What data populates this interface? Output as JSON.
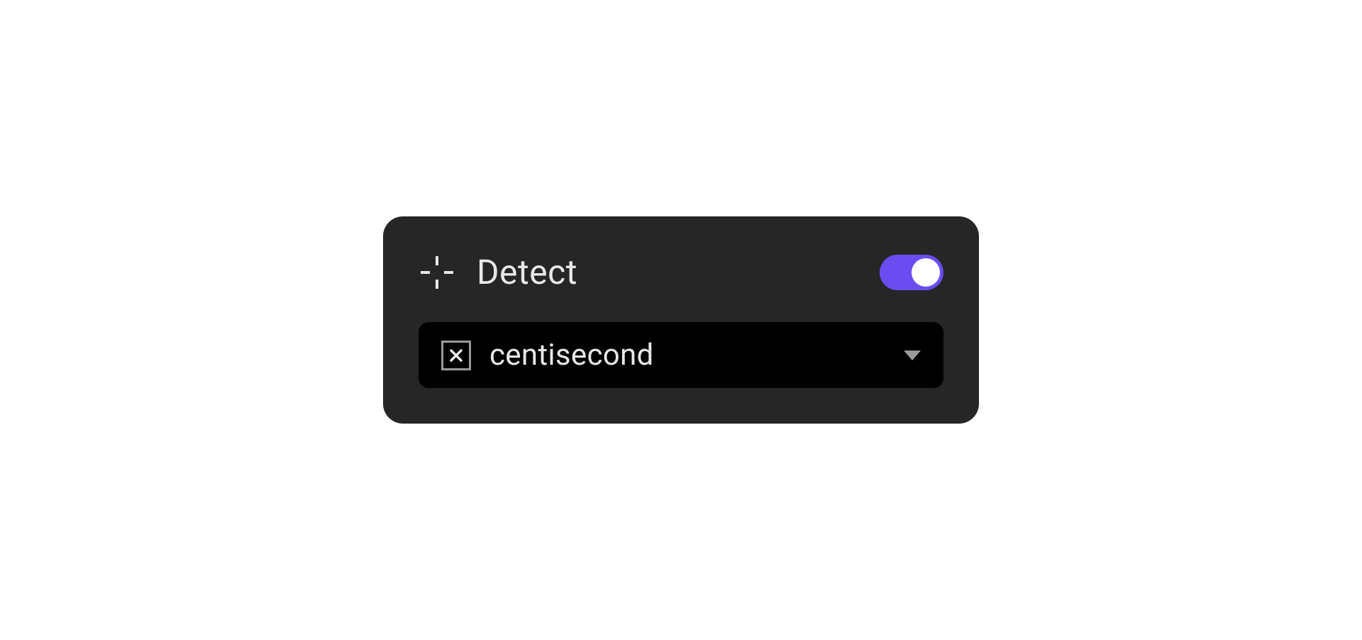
{
  "panel": {
    "title": "Detect",
    "toggle_on": true
  },
  "dropdown": {
    "selected": "centisecond"
  },
  "colors": {
    "card_bg": "#262626",
    "dropdown_bg": "#000000",
    "text": "#e8e8e8",
    "accent": "#6b4cf0",
    "muted": "#9a9a9a"
  }
}
